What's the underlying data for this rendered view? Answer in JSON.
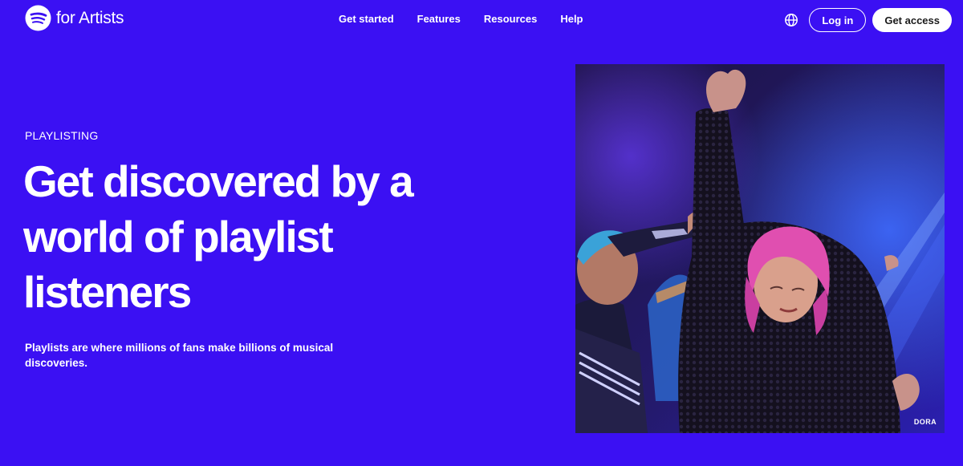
{
  "header": {
    "brand": "for Artists",
    "nav": [
      "Get started",
      "Features",
      "Resources",
      "Help"
    ],
    "login_label": "Log in",
    "access_label": "Get access"
  },
  "hero": {
    "eyebrow": "PLAYLISTING",
    "headline": "Get discovered by a world of playlist listeners",
    "subtext": "Playlists are where millions of fans make billions of musical discoveries.",
    "photo_credit": "DORA"
  },
  "colors": {
    "background": "#3b10f3",
    "button_fill": "#ffffff",
    "text": "#ffffff"
  },
  "icons": {
    "logo": "spotify-logo-icon",
    "language": "globe-icon"
  }
}
